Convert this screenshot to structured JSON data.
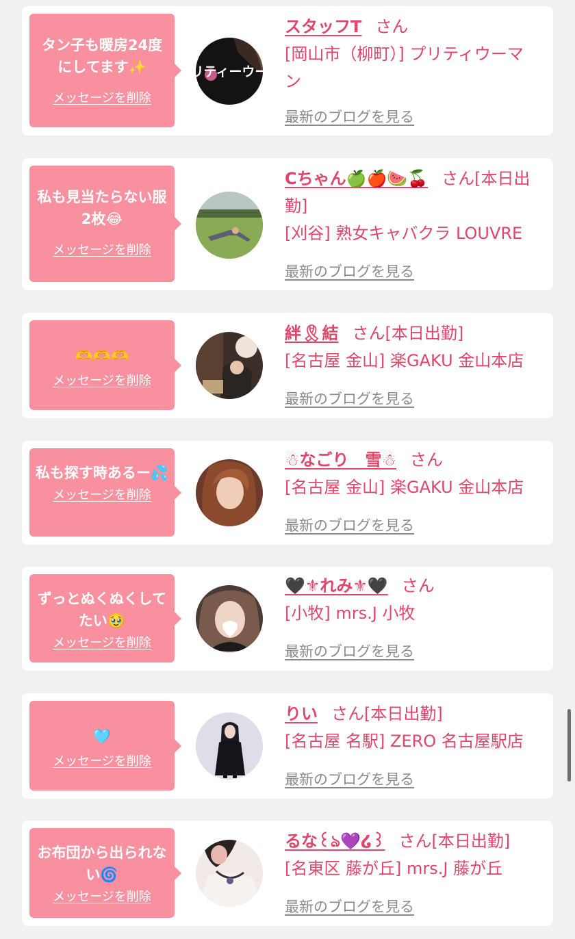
{
  "entries": [
    {
      "message": "タン子も暖房24度にしてます✨",
      "delete_label": "メッセージを削除",
      "name": "スタッフT",
      "suffix": "さん",
      "shop": "[岡山市（柳町）] プリティウーマン",
      "blog_label": "最新のブログを見る",
      "avatar_icon": "shop-logo-avatar-pretty-woman",
      "avatar_text": "プリティーウーマ"
    },
    {
      "message": "私も見当たらない服2枚😂",
      "delete_label": "メッセージを削除",
      "name": "Cちゃん🍏🍎🍉🍒",
      "suffix": "さん[本日出勤]",
      "shop": "[刈谷] 熟女キャバクラ LOUVRE",
      "blog_label": "最新のブログを見る",
      "avatar_icon": "photo-avatar-person-on-grass"
    },
    {
      "message": "🫶🫶🫶",
      "delete_label": "メッセージを削除",
      "name": "絆🎗結",
      "suffix": "さん[本日出勤]",
      "shop": "[名古屋 金山] 楽GAKU 金山本店",
      "blog_label": "最新のブログを見る",
      "avatar_icon": "photo-avatar-woman-blurred"
    },
    {
      "message": "私も探す時あるー💦",
      "delete_label": "メッセージを削除",
      "name": "☃なごり　雪☃",
      "suffix": "さん",
      "shop": "[名古屋 金山] 楽GAKU 金山本店",
      "blog_label": "最新のブログを見る",
      "avatar_icon": "photo-avatar-woman-portrait"
    },
    {
      "message": "ずっとぬくぬくしてたい🥹",
      "delete_label": "メッセージを削除",
      "name": "🖤⚜れみ⚜🖤",
      "suffix": "さん",
      "shop": "[小牧] mrs.J 小牧",
      "blog_label": "最新のブログを見る",
      "avatar_icon": "photo-avatar-woman-heart-sticker"
    },
    {
      "message": "🩵",
      "delete_label": "メッセージを削除",
      "name": "りい",
      "suffix": "さん[本日出勤]",
      "shop": "[名古屋 名駅] ZERO 名古屋駅店",
      "blog_label": "最新のブログを見る",
      "avatar_icon": "photo-avatar-woman-black-dress"
    },
    {
      "message": "お布団から出られない🌀",
      "delete_label": "メッセージを削除",
      "name": "るな꒰ঌ💜໒꒱",
      "suffix": "さん[本日出勤]",
      "shop": "[名東区 藤が丘] mrs.J 藤が丘",
      "blog_label": "最新のブログを見る",
      "avatar_icon": "photo-avatar-woman-necklace"
    }
  ]
}
